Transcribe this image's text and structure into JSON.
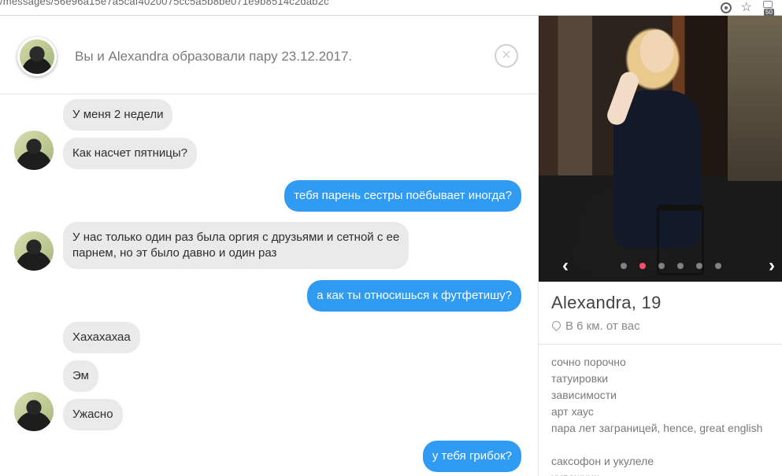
{
  "browser": {
    "url": "/messages/56e96a15e7a5caf4020075cc5a5b8be071e9b8514c2dab2c",
    "ext_badge": "50"
  },
  "header": {
    "match_text": "Вы и Alexandra образовали пару 23.12.2017."
  },
  "messages": [
    {
      "from": "them",
      "text": "У меня 2 недели"
    },
    {
      "from": "them",
      "text": "Как насчет пятницы?"
    },
    {
      "from": "me",
      "text": "тебя парень сестры поёбывает иногда?"
    },
    {
      "from": "them",
      "text": "У нас только один раз была оргия с друзьями и сетной с ее"
    },
    {
      "from": "them",
      "text": "парнем, но эт было давно и один раз"
    },
    {
      "from": "me",
      "text": "а как ты относишься к футфетишу?"
    },
    {
      "from": "them",
      "text": "Хахахахаа"
    },
    {
      "from": "them",
      "text": "Эм"
    },
    {
      "from": "them",
      "text": "Ужасно"
    },
    {
      "from": "me",
      "text": "у тебя грибок?"
    }
  ],
  "profile": {
    "name_age": "Alexandra, 19",
    "distance": "В 6 км. от вас",
    "photo_count": 6,
    "active_photo": 2,
    "bio": [
      "сочно порочно",
      "татуировки",
      "зависимости",
      "арт хаус",
      "пара лет заграницей, hence, great english",
      "",
      "саксофон и укулеле",
      "художник"
    ]
  },
  "colors": {
    "outgoing_bubble": "#2f9bf2",
    "incoming_bubble": "#eaeaea",
    "accent": "#fd5068"
  }
}
